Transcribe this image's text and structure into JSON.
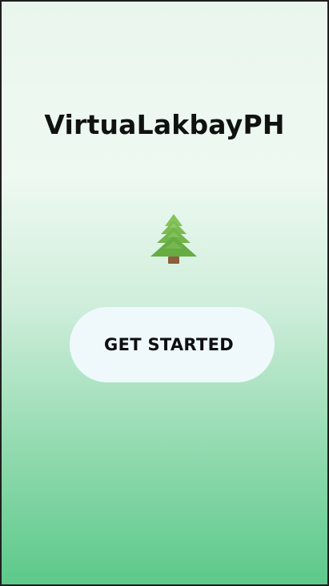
{
  "app": {
    "title": "VirtuaLakbayPH"
  },
  "hero": {
    "icon": "evergreen-tree-icon"
  },
  "actions": {
    "get_started_label": "GET STARTED"
  },
  "colors": {
    "gradient_top": "#e9f6ee",
    "gradient_bottom": "#5cc98a",
    "button_background": "#eff9fb",
    "tree_green": "#6fb24a",
    "tree_trunk": "#8b5e3c"
  }
}
